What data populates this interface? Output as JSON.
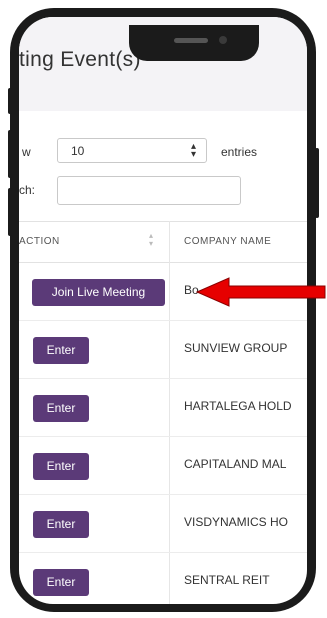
{
  "page": {
    "title": "ting Event(s)",
    "show_label": "w",
    "entries_label": "entries",
    "search_label": "ch:",
    "entries_select": {
      "value": "10",
      "icon": "sort-arrows-icon"
    },
    "search_value": ""
  },
  "table": {
    "columns": [
      "ACTION",
      "COMPANY NAME"
    ],
    "rows": [
      {
        "action": "Join Live Meeting",
        "company": "Bo"
      },
      {
        "action": "Enter",
        "company": "SUNVIEW GROUP"
      },
      {
        "action": "Enter",
        "company": "HARTALEGA HOLD"
      },
      {
        "action": "Enter",
        "company": "CAPITALAND MAL"
      },
      {
        "action": "Enter",
        "company": "VISDYNAMICS HO"
      },
      {
        "action": "Enter",
        "company": "SENTRAL REIT"
      }
    ]
  },
  "colors": {
    "accent": "#5b3a78",
    "arrow": "#e60000",
    "header_bg": "#f4f3f6",
    "phone_frame": "#1b1b1b"
  }
}
